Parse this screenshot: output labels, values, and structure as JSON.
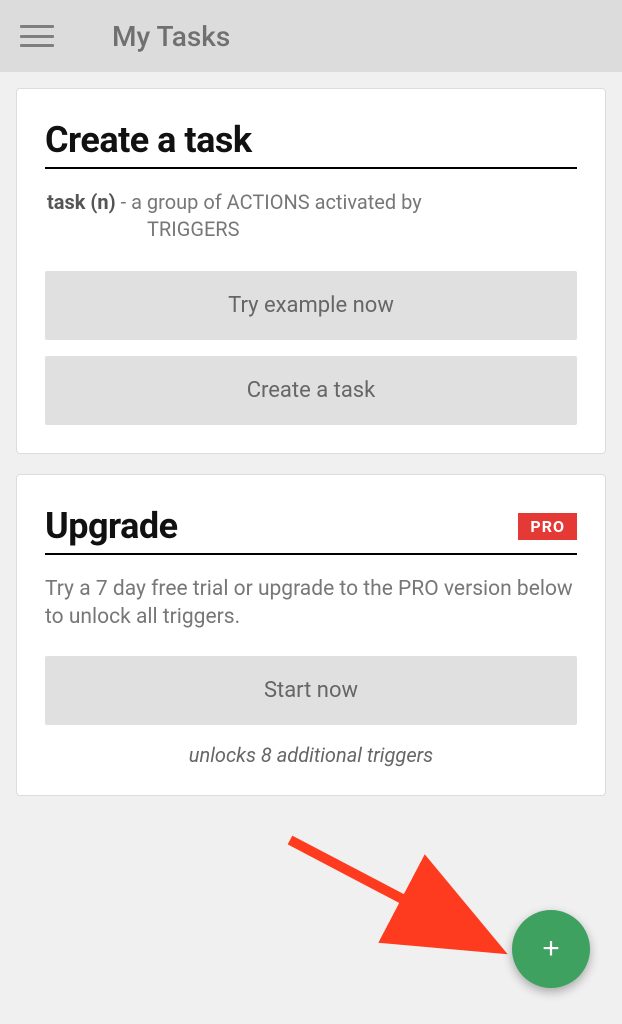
{
  "appbar": {
    "title": "My Tasks"
  },
  "card_create": {
    "title": "Create a task",
    "term": "task (n)",
    "separator": " - ",
    "definition_line1": "a group of ACTIONS activated by",
    "definition_line2": "TRIGGERS",
    "try_example_label": "Try example now",
    "create_task_label": "Create a task"
  },
  "card_upgrade": {
    "title": "Upgrade",
    "pro_badge": "PRO",
    "description": "Try a 7 day free trial or upgrade to the PRO version below to unlock all triggers.",
    "start_label": "Start now",
    "unlocks_note": "unlocks 8 additional triggers"
  },
  "fab": {
    "plus": "+"
  }
}
